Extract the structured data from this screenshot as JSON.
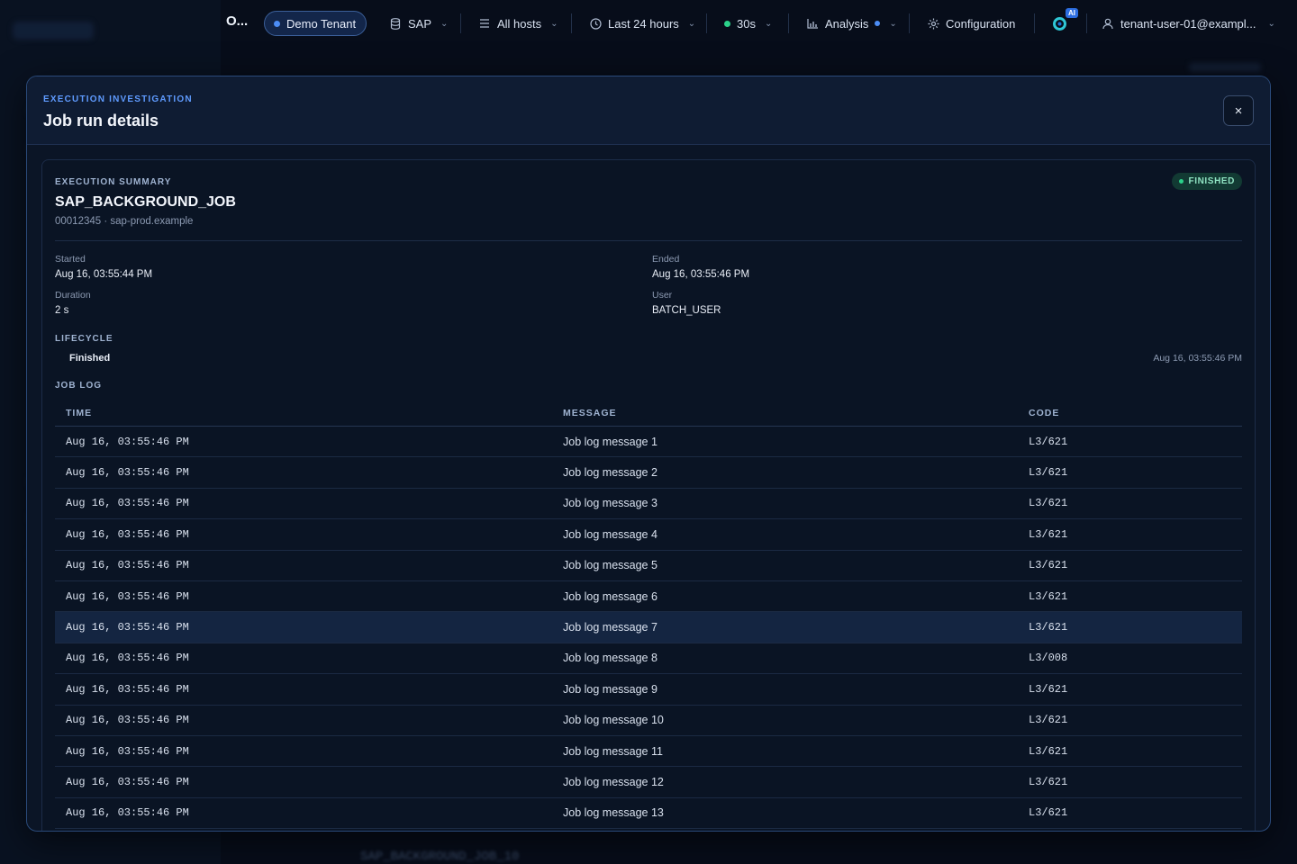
{
  "topbar": {
    "brand": "O...",
    "tenant": "Demo Tenant",
    "system": "SAP",
    "hosts": "All hosts",
    "time_range": "Last 24 hours",
    "refresh": "30s",
    "analysis": "Analysis",
    "configuration": "Configuration",
    "ai_badge": "AI",
    "user": "tenant-user-01@exampl...",
    "icons": [
      "database-icon",
      "list-icon",
      "clock-icon",
      "bar-chart-icon",
      "gear-icon",
      "assistant-icon",
      "user-icon"
    ]
  },
  "background": {
    "footer_text": "SAP_BACKGROUND_JOB_10"
  },
  "modal": {
    "eyebrow": "EXECUTION INVESTIGATION",
    "title": "Job run details",
    "close_label": "×"
  },
  "summary": {
    "section_label": "EXECUTION SUMMARY",
    "job_name": "SAP_BACKGROUND_JOB",
    "subtitle": "00012345 · sap-prod.example",
    "status": "FINISHED",
    "status_color": "#2bd18a",
    "started_label": "Started",
    "started_value": "Aug 16, 03:55:44 PM",
    "ended_label": "Ended",
    "ended_value": "Aug 16, 03:55:46 PM",
    "duration_label": "Duration",
    "duration_value": "2 s",
    "user_label": "User",
    "user_value": "BATCH_USER"
  },
  "lifecycle": {
    "section_label": "LIFECYCLE",
    "state": "Finished",
    "time": "Aug 16, 03:55:46 PM"
  },
  "job_log": {
    "section_label": "JOB LOG",
    "columns": [
      "TIME",
      "MESSAGE",
      "CODE"
    ],
    "highlighted_row": 6,
    "rows": [
      {
        "time": "Aug 16, 03:55:46 PM",
        "message": "Job log message 1",
        "code": "L3/621"
      },
      {
        "time": "Aug 16, 03:55:46 PM",
        "message": "Job log message 2",
        "code": "L3/621"
      },
      {
        "time": "Aug 16, 03:55:46 PM",
        "message": "Job log message 3",
        "code": "L3/621"
      },
      {
        "time": "Aug 16, 03:55:46 PM",
        "message": "Job log message 4",
        "code": "L3/621"
      },
      {
        "time": "Aug 16, 03:55:46 PM",
        "message": "Job log message 5",
        "code": "L3/621"
      },
      {
        "time": "Aug 16, 03:55:46 PM",
        "message": "Job log message 6",
        "code": "L3/621"
      },
      {
        "time": "Aug 16, 03:55:46 PM",
        "message": "Job log message 7",
        "code": "L3/621"
      },
      {
        "time": "Aug 16, 03:55:46 PM",
        "message": "Job log message 8",
        "code": "L3/008"
      },
      {
        "time": "Aug 16, 03:55:46 PM",
        "message": "Job log message 9",
        "code": "L3/621"
      },
      {
        "time": "Aug 16, 03:55:46 PM",
        "message": "Job log message 10",
        "code": "L3/621"
      },
      {
        "time": "Aug 16, 03:55:46 PM",
        "message": "Job log message 11",
        "code": "L3/621"
      },
      {
        "time": "Aug 16, 03:55:46 PM",
        "message": "Job log message 12",
        "code": "L3/621"
      },
      {
        "time": "Aug 16, 03:55:46 PM",
        "message": "Job log message 13",
        "code": "L3/621"
      }
    ]
  }
}
